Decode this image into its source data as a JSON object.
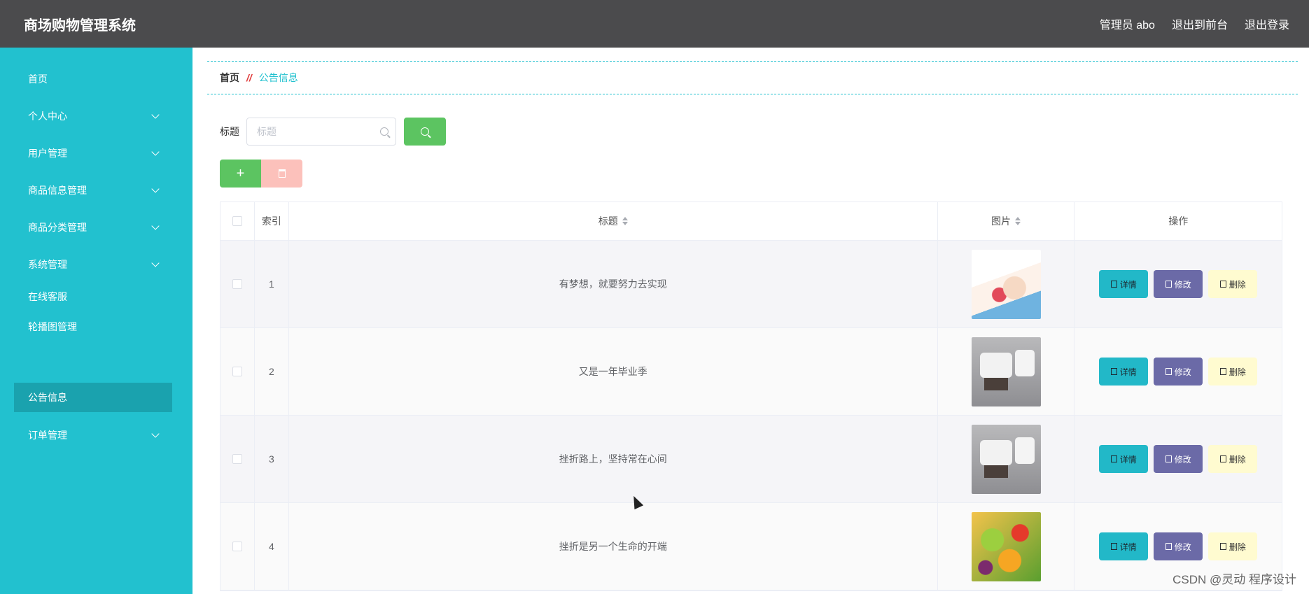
{
  "header": {
    "app_title": "商场购物管理系统",
    "admin_label": "管理员 abo",
    "to_frontend": "退出到前台",
    "logout": "退出登录"
  },
  "sidebar": {
    "items": [
      {
        "label": "首页",
        "expandable": false
      },
      {
        "label": "个人中心",
        "expandable": true
      },
      {
        "label": "用户管理",
        "expandable": true
      },
      {
        "label": "商品信息管理",
        "expandable": true
      },
      {
        "label": "商品分类管理",
        "expandable": true
      },
      {
        "label": "系统管理",
        "expandable": true
      },
      {
        "label": "在线客服",
        "expandable": false
      },
      {
        "label": "轮播图管理",
        "expandable": false
      },
      {
        "label": "公告信息",
        "expandable": false,
        "active": true
      },
      {
        "label": "订单管理",
        "expandable": true
      }
    ]
  },
  "breadcrumb": {
    "home": "首页",
    "separator": "//",
    "current": "公告信息"
  },
  "search": {
    "label": "标题",
    "placeholder": "标题",
    "icon": "search-icon"
  },
  "actions": {
    "add_symbol": "+",
    "add_icon": "plus-icon",
    "delete_icon": "trash-icon"
  },
  "table": {
    "columns": {
      "index": "索引",
      "title": "标题",
      "image": "图片",
      "operation": "操作"
    },
    "rows": [
      {
        "index": "1",
        "title": "有梦想，就要努力去实现",
        "image": "cartoon-image"
      },
      {
        "index": "2",
        "title": "又是一年毕业季",
        "image": "sofa-image"
      },
      {
        "index": "3",
        "title": "挫折路上，坚持常在心间",
        "image": "sofa-image"
      },
      {
        "index": "4",
        "title": "挫折是另一个生命的开端",
        "image": "fruit-image"
      }
    ],
    "op_labels": {
      "detail": "详情",
      "edit": "修改",
      "delete": "删除"
    }
  },
  "watermark": "CSDN @灵动 程序设计",
  "colors": {
    "header": "#4b4b4d",
    "sidebar": "#22c1cf",
    "sidebar_active": "#1aa2ae",
    "accent_green": "#5cc461",
    "edit": "#6b6aa7",
    "delete_bg": "#fffbd0"
  }
}
